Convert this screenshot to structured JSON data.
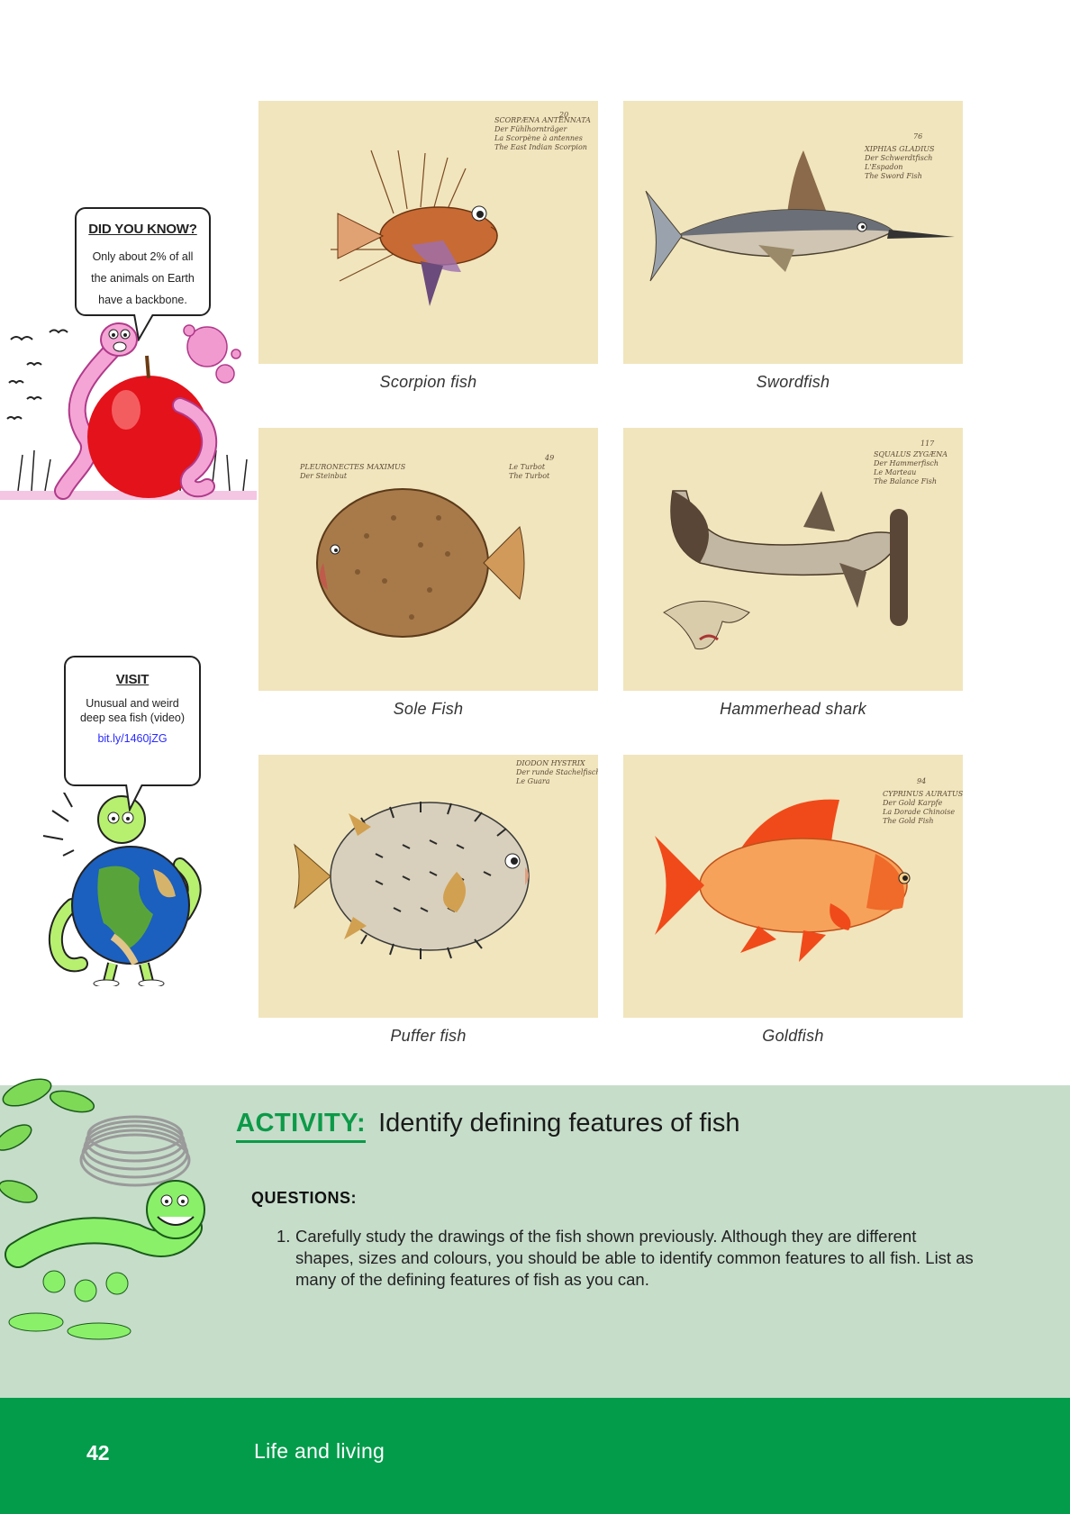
{
  "fish": [
    {
      "caption": "Scorpion fish",
      "plate_text": [
        "SCORPÆNA ANTENNATA",
        "Der Fühlhornträger",
        "La Scorpène à antennes",
        "The East Indian Scorpion"
      ],
      "plate_number": "20"
    },
    {
      "caption": "Swordfish",
      "plate_text": [
        "XIPHIAS GLADIUS",
        "Der Schwerdtfisch",
        "L'Espadon",
        "The Sword Fish"
      ],
      "plate_number": "76"
    },
    {
      "caption": "Sole Fish",
      "plate_text": [
        "PLEURONECTES MAXIMUS",
        "Der Steinbut",
        "Le Turbot",
        "The Turbot"
      ],
      "plate_number": "49"
    },
    {
      "caption": "Hammerhead shark",
      "plate_text": [
        "SQUALUS ZYGÆNA",
        "Der Hammerfisch",
        "Le Marteau",
        "The Balance Fish"
      ],
      "plate_number": "117"
    },
    {
      "caption": "Puffer fish",
      "plate_text": [
        "DIODON HYSTRIX",
        "Der runde Stachelfisch",
        "Le Guara"
      ],
      "plate_number": ""
    },
    {
      "caption": "Goldfish",
      "plate_text": [
        "CYPRINUS AURATUS",
        "Der Gold Karpfe",
        "La Dorade Chinoise",
        "The Gold Fish"
      ],
      "plate_number": "94"
    }
  ],
  "did_you_know": {
    "title": "DID YOU KNOW?",
    "text": "Only about 2% of all the animals on Earth have a backbone."
  },
  "visit": {
    "title": "VISIT",
    "text": "Unusual and weird deep sea fish (video)",
    "link": "bit.ly/1460jZG"
  },
  "activity": {
    "label": "ACTIVITY:",
    "title": "Identify defining features of fish",
    "questions_heading": "QUESTIONS:",
    "questions": [
      {
        "number": "1.",
        "text": "Carefully study the drawings of the fish shown previously. Although they are different shapes, sizes and colours, you should be able to identify common features to all fish. List as many of the defining features of fish as you can."
      }
    ]
  },
  "footer": {
    "page_number": "42",
    "chapter": "Life and living"
  },
  "colors": {
    "accent_green": "#039c4b",
    "activity_bg": "#c6ddca",
    "plate_bg": "#f1e5bd"
  }
}
